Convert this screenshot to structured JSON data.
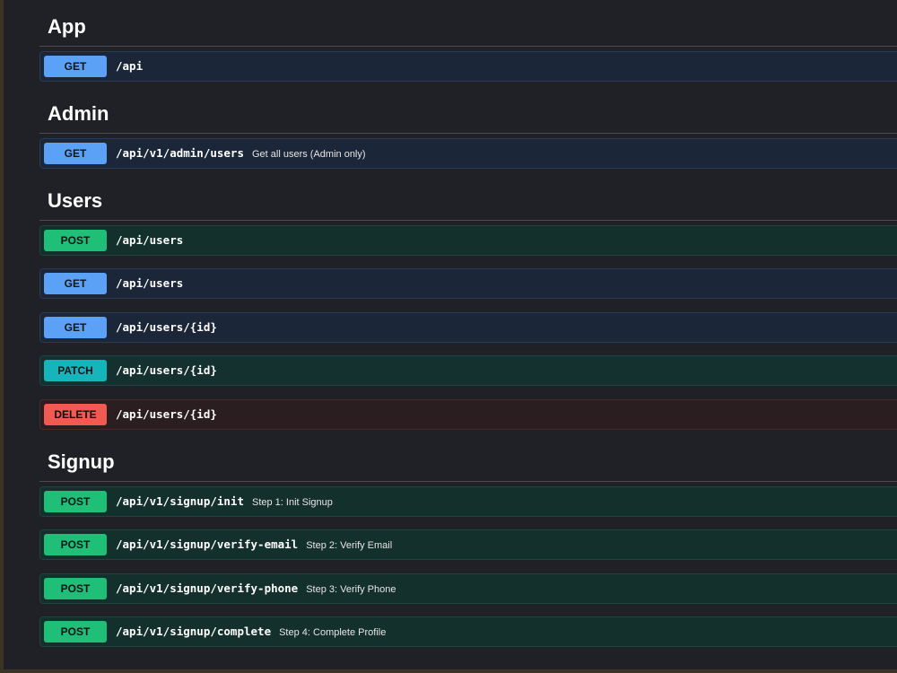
{
  "sections": [
    {
      "title": "App",
      "operations": [
        {
          "method": "GET",
          "path": "/api",
          "summary": ""
        }
      ]
    },
    {
      "title": "Admin",
      "operations": [
        {
          "method": "GET",
          "path": "/api/v1/admin/users",
          "summary": "Get all users (Admin only)"
        }
      ]
    },
    {
      "title": "Users",
      "operations": [
        {
          "method": "POST",
          "path": "/api/users",
          "summary": ""
        },
        {
          "method": "GET",
          "path": "/api/users",
          "summary": ""
        },
        {
          "method": "GET",
          "path": "/api/users/{id}",
          "summary": ""
        },
        {
          "method": "PATCH",
          "path": "/api/users/{id}",
          "summary": ""
        },
        {
          "method": "DELETE",
          "path": "/api/users/{id}",
          "summary": ""
        }
      ]
    },
    {
      "title": "Signup",
      "operations": [
        {
          "method": "POST",
          "path": "/api/v1/signup/init",
          "summary": "Step 1: Init Signup"
        },
        {
          "method": "POST",
          "path": "/api/v1/signup/verify-email",
          "summary": "Step 2: Verify Email"
        },
        {
          "method": "POST",
          "path": "/api/v1/signup/verify-phone",
          "summary": "Step 3: Verify Phone"
        },
        {
          "method": "POST",
          "path": "/api/v1/signup/complete",
          "summary": "Step 4: Complete Profile"
        }
      ]
    }
  ],
  "colors": {
    "get": "#5ba1f5",
    "post": "#1fbf78",
    "patch": "#16b5bb",
    "delete": "#f05a50"
  }
}
